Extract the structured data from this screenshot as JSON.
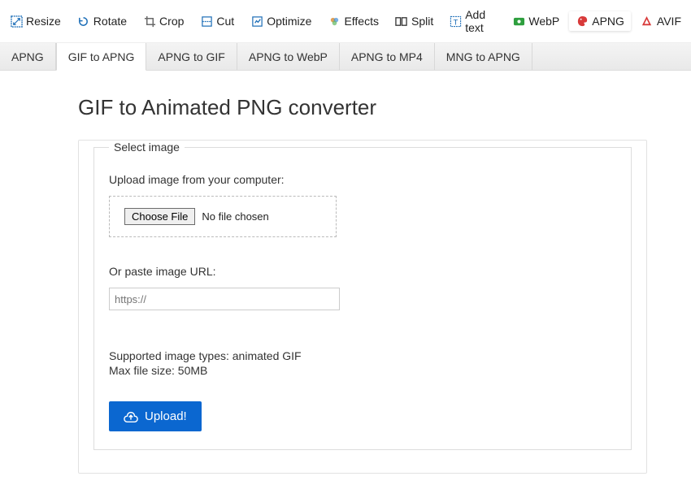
{
  "toolbar": {
    "items": [
      {
        "label": "Resize",
        "icon": "resize",
        "active": false
      },
      {
        "label": "Rotate",
        "icon": "rotate",
        "active": false
      },
      {
        "label": "Crop",
        "icon": "crop",
        "active": false
      },
      {
        "label": "Cut",
        "icon": "cut",
        "active": false
      },
      {
        "label": "Optimize",
        "icon": "optimize",
        "active": false
      },
      {
        "label": "Effects",
        "icon": "effects",
        "active": false
      },
      {
        "label": "Split",
        "icon": "split",
        "active": false
      },
      {
        "label": "Add text",
        "icon": "addtext",
        "active": false
      },
      {
        "label": "WebP",
        "icon": "webp",
        "active": false
      },
      {
        "label": "APNG",
        "icon": "apng",
        "active": true
      },
      {
        "label": "AVIF",
        "icon": "avif",
        "active": false
      }
    ]
  },
  "tabs": [
    {
      "label": "APNG",
      "active": false
    },
    {
      "label": "GIF to APNG",
      "active": true
    },
    {
      "label": "APNG to GIF",
      "active": false
    },
    {
      "label": "APNG to WebP",
      "active": false
    },
    {
      "label": "APNG to MP4",
      "active": false
    },
    {
      "label": "MNG to APNG",
      "active": false
    }
  ],
  "page": {
    "title": "GIF to Animated PNG converter"
  },
  "form": {
    "legend": "Select image",
    "upload_label": "Upload image from your computer:",
    "choose_file_label": "Choose File",
    "file_status": "No file chosen",
    "url_label": "Or paste image URL:",
    "url_placeholder": "https://",
    "supported_line": "Supported image types: animated GIF",
    "max_size_line": "Max file size: 50MB",
    "upload_button": "Upload!"
  },
  "icons": {
    "resize": {
      "color": "#1e6fb8"
    },
    "rotate": {
      "color": "#1e6fb8"
    },
    "crop": {
      "color": "#6a6a6a"
    },
    "cut": {
      "color": "#1e6fb8"
    },
    "optimize": {
      "color": "#1e6fb8"
    },
    "effects": {
      "color": "#b07030"
    },
    "split": {
      "color": "#333333"
    },
    "addtext": {
      "color": "#1e6fb8"
    },
    "webp": {
      "color": "#2e9f3e"
    },
    "apng": {
      "color": "#d83a3a"
    },
    "avif": {
      "color": "#d83a3a"
    }
  }
}
